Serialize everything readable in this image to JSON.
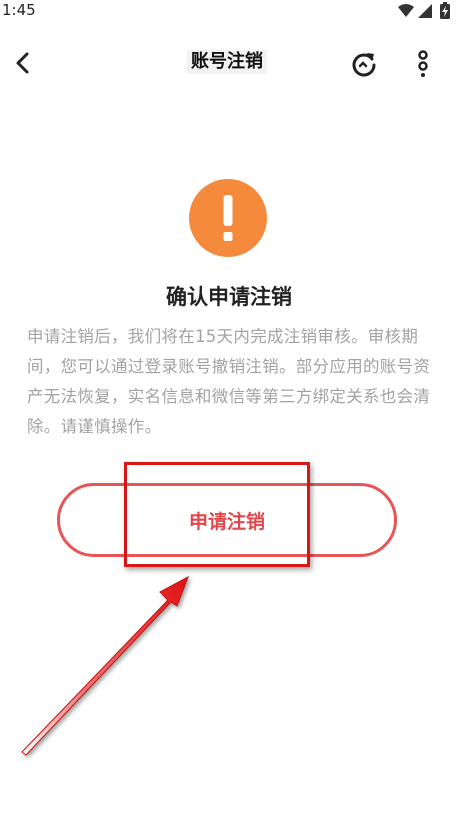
{
  "status_bar": {
    "time": "1:45",
    "icons": [
      "wifi-icon",
      "signal-icon",
      "battery-charging-icon"
    ]
  },
  "header": {
    "title": "账号注销",
    "back_icon": "chevron-left-icon",
    "refresh_icon": "refresh-icon",
    "more_icon": "more-vertical-icon"
  },
  "main": {
    "warning_icon": "exclamation-icon",
    "warning_color": "#f58a3d",
    "heading": "确认申请注销",
    "description": "申请注销后，我们将在15天内完成注销审核。审核期间，您可以通过登录账号撤销注销。部分应用的账号资产无法恢复，实名信息和微信等第三方绑定关系也会清除。请谨慎操作。",
    "apply_button_label": "申请注销",
    "accent_color": "#e85557"
  },
  "annotation": {
    "highlight_color": "#d61717"
  }
}
